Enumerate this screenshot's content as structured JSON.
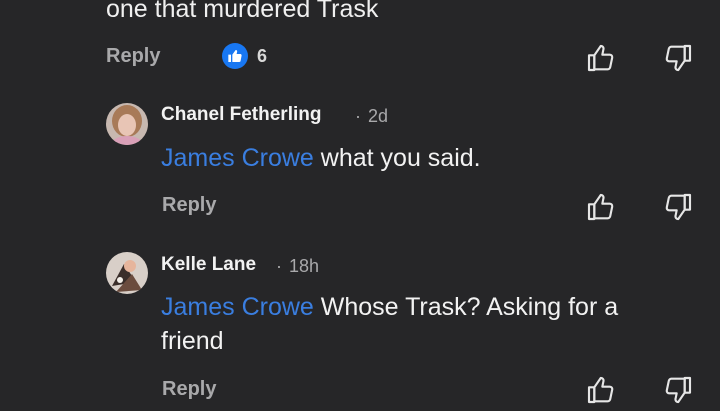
{
  "previous_comment": {
    "text_tail": "one that murdered Trask",
    "reply_label": "Reply",
    "like_count": "6"
  },
  "replies": [
    {
      "author": "Chanel Fetherling",
      "separator": "·",
      "age": "2d",
      "mention": "James Crowe",
      "text": "what you said.",
      "reply_label": "Reply"
    },
    {
      "author": "Kelle Lane",
      "separator": "·",
      "age": "18h",
      "mention": "James Crowe",
      "text_line1": "Whose Trask? Asking for a",
      "text_line2": "friend",
      "reply_label": "Reply"
    }
  ],
  "colors": {
    "background": "#262628",
    "mention": "#3a7ee0",
    "like_badge": "#1877f2",
    "muted": "#a9a9ab"
  },
  "icons": [
    "thumbs-up-icon",
    "thumbs-down-icon",
    "like-reaction-icon"
  ]
}
